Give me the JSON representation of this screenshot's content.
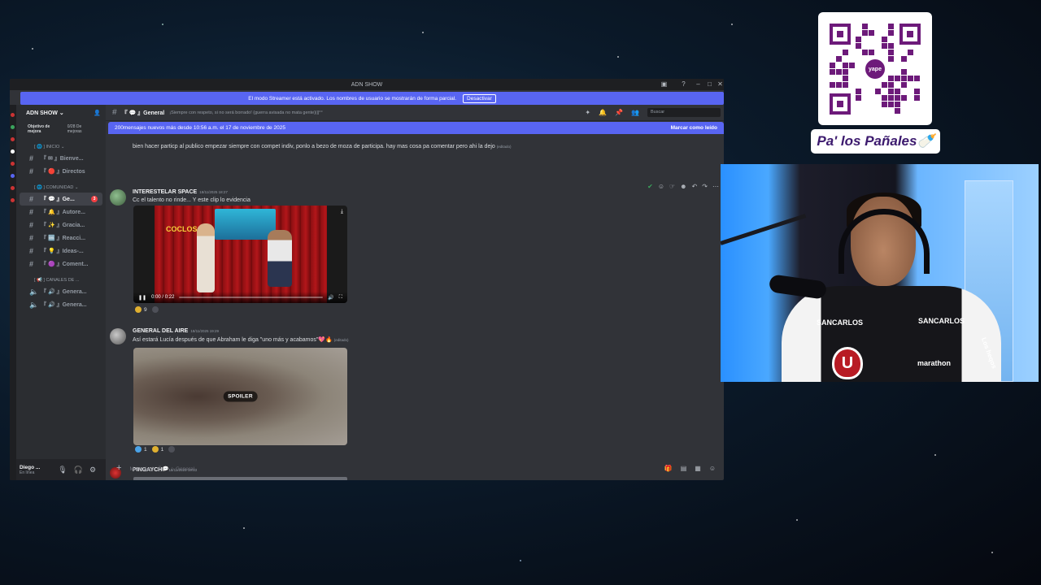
{
  "window": {
    "title": "ADN SHOW",
    "streamer_banner": "El modo Streamer está activado. Los nombres de usuario se mostrarán de forma parcial.",
    "streamer_button": "Desactivar"
  },
  "server": {
    "name": "ADN SHOW ⌄",
    "goal_label": "Objetivo de mejora",
    "goal_value": "0/28 De mejoras"
  },
  "sidebar": {
    "categories": [
      "[ 🌐 ] INICIO ⌄",
      "[ 🌐 ] COMUNIDAD ⌄",
      "[ 📢 ] CANALES DE ..."
    ],
    "inicio": [
      {
        "label": "『 ✉ 』Bienve..."
      },
      {
        "label": "『 🔴 』Directos"
      }
    ],
    "comunidad": [
      {
        "label": "『 💬 』Ge...",
        "badge": "3"
      },
      {
        "label": "『 🔔 』Autore..."
      },
      {
        "label": "『 ✨ 』Gracia..."
      },
      {
        "label": "『 🆒 』Reacci..."
      },
      {
        "label": "『 💡 』Ideas-..."
      },
      {
        "label": "『 🟣 』Coment..."
      }
    ],
    "voice": [
      {
        "label": "『 🔊 』Genera..."
      },
      {
        "label": "『 🔊 』Genera..."
      }
    ]
  },
  "user": {
    "name": "Diego ...",
    "status": "En línea"
  },
  "channel": {
    "name": "『 💬 』General",
    "topic": "¡Siempre con respeto, si no será borrado! (guerra avisada no mata gente)|||°°",
    "search_placeholder": "Buscar"
  },
  "new_messages": {
    "text": "200mensajes nuevos más desde 10:56 a.m. el 17 de noviembre de 2025",
    "mark_read": "Marcar como leído"
  },
  "messages": [
    {
      "text": "bien hacer particp al publico empezar siempre con compet indiv, ponlo a bezo de moza de participa. hay mas cosa pa comentar pero ahi la dejo",
      "edited": "(editado)"
    },
    {
      "author": "INTERESTELAR SPACE",
      "time": "18/11/2025 18:27",
      "text": "Cc el talento no rinde... Y este clip lo evidencia",
      "video_time": "0:00 / 0:22",
      "video_progress": 0.0,
      "video_logo": "COCLOS",
      "reactions": [
        {
          "count": "9",
          "color": "#e0b030"
        }
      ]
    },
    {
      "author": "GENERAL DEL AIRE",
      "time": "18/11/2025 19:29",
      "text": "Así estará Lucía después de que Abraham le diga \"uno más y acabamos\"💖🔥",
      "edited": "(editado)",
      "spoiler": "SPOILER",
      "reactions": [
        {
          "count": "1",
          "color": "#4aa3e8"
        },
        {
          "count": "1",
          "color": "#e0b030"
        }
      ]
    },
    {
      "author": "PINGAYCHU",
      "time": "18/11/2025 19:33"
    }
  ],
  "composer": {
    "placeholder": "Mensaje # 『 💬 』General"
  },
  "overlay": {
    "qr_brand": "yape",
    "panales": "Pa' los Pañales🍼"
  },
  "webcam": {
    "shirt_sponsors": [
      "SANCARLOS",
      "SANCARLOS",
      "marathon",
      "Los heqos"
    ],
    "crest": "U"
  },
  "colors": {
    "blurple": "#5865f2",
    "discord_bg": "#313338",
    "sidebar_bg": "#2b2d31",
    "yape_purple": "#6d1a7a"
  },
  "icons": {
    "header": [
      "threads-icon",
      "bell-icon",
      "pin-icon",
      "members-icon"
    ],
    "composer": [
      "gift-icon",
      "gif-icon",
      "sticker-icon",
      "emoji-icon"
    ],
    "user_panel": [
      "mic-icon",
      "headphones-icon",
      "settings-icon"
    ]
  }
}
